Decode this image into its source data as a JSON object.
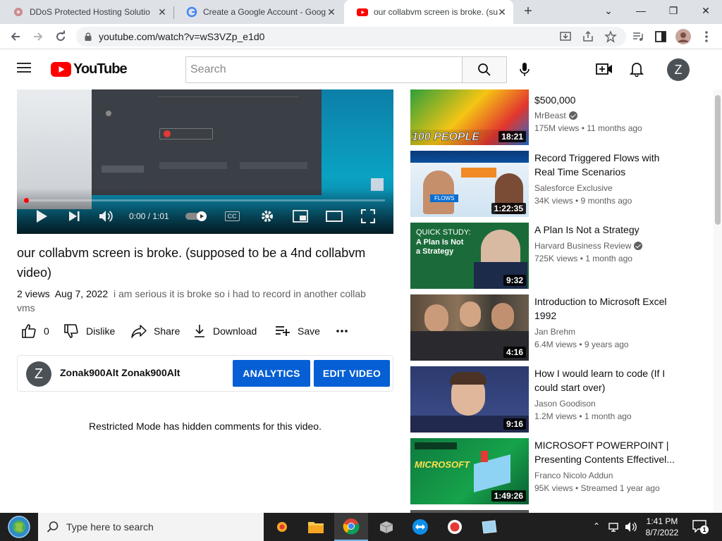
{
  "browser": {
    "tabs": [
      {
        "title": "DDoS Protected Hosting Solutio",
        "favicon": "gear-flower-icon"
      },
      {
        "title": "Create a Google Account - Goog",
        "favicon": "google-g-icon"
      },
      {
        "title": "our collabvm screen is broke. (su",
        "favicon": "youtube-icon"
      }
    ],
    "new_tab": "+",
    "url": "youtube.com/watch?v=wS3VZp_e1d0"
  },
  "youtube": {
    "logo_text": "YouTube",
    "search_placeholder": "Search",
    "avatar_letter": "Z"
  },
  "player": {
    "time": "0:00 / 1:01",
    "cc": "CC"
  },
  "video": {
    "title": "our collabvm screen is broke. (supposed to be a 4nd collabvm video)",
    "views": "2 views",
    "date": "Aug 7, 2022",
    "description": "i am serious it is broke so i had to record in another collab vms",
    "likes": "0",
    "dislike_label": "Dislike",
    "share_label": "Share",
    "download_label": "Download",
    "save_label": "Save"
  },
  "channel": {
    "avatar_letter": "Z",
    "name": "Zonak900Alt Zonak900Alt",
    "analytics_label": "ANALYTICS",
    "edit_label": "EDIT VIDEO"
  },
  "comments_notice": "Restricted Mode has hidden comments for this video.",
  "recommendations": [
    {
      "title": "$500,000",
      "channel": "MrBeast",
      "verified": true,
      "meta": "175M views • 11 months ago",
      "duration": "18:21",
      "thumb_text": "100 PEOPLE"
    },
    {
      "title": "Record Triggered Flows with Real Time Scenarios",
      "channel": "Salesforce Exclusive",
      "verified": false,
      "meta": "34K views • 9 months ago",
      "duration": "1:22:35",
      "thumb_text": "FLOWS"
    },
    {
      "title": "A Plan Is Not a Strategy",
      "channel": "Harvard Business Review",
      "verified": true,
      "meta": "725K views • 1 month ago",
      "duration": "9:32",
      "thumb_text": "QUICK STUDY:",
      "thumb_text2": "A Plan Is Not a Strategy"
    },
    {
      "title": "Introduction to Microsoft Excel 1992",
      "channel": "Jan Brehm",
      "verified": false,
      "meta": "6.4M views • 9 years ago",
      "duration": "4:16"
    },
    {
      "title": "How I would learn to code (If I could start over)",
      "channel": "Jason Goodison",
      "verified": false,
      "meta": "1.2M views • 1 month ago",
      "duration": "9:16"
    },
    {
      "title": "MICROSOFT POWERPOINT | Presenting Contents Effectivel...",
      "channel": "Franco Nicolo Addun",
      "verified": false,
      "meta": "95K views • Streamed 1 year ago",
      "duration": "1:49:26",
      "thumb_text": "MICROSOFT"
    }
  ],
  "taskbar": {
    "search_placeholder": "Type here to search",
    "time": "1:41 PM",
    "date": "8/7/2022",
    "notifications": "1"
  },
  "colors": {
    "youtube_red": "#ff0000",
    "button_blue": "#065fd4",
    "taskbar": "#1f1f1f"
  }
}
